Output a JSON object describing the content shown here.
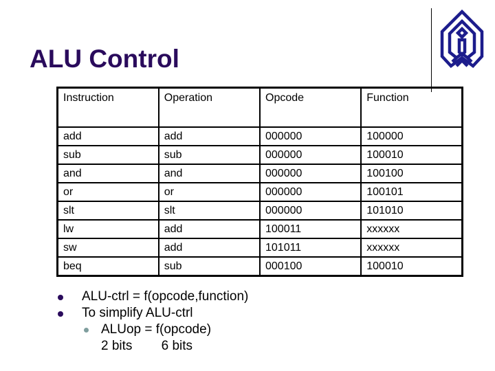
{
  "slide": {
    "title": "ALU Control",
    "logo_icon": "university-emblem-logo",
    "colors": {
      "title": "#2a0b5c",
      "bullet": "#2a0b5c",
      "sub_bullet": "#7f9e9e",
      "logo": "#1c1c8c"
    }
  },
  "table": {
    "headers": [
      "Instruction",
      "Operation",
      "Opcode",
      "Function"
    ],
    "rows": [
      [
        "add",
        "add",
        "000000",
        "100000"
      ],
      [
        "sub",
        "sub",
        "000000",
        "100010"
      ],
      [
        "and",
        "and",
        "000000",
        "100100"
      ],
      [
        "or",
        "or",
        "000000",
        "100101"
      ],
      [
        "slt",
        "slt",
        "000000",
        "101010"
      ],
      [
        "lw",
        "add",
        "100011",
        "xxxxxx"
      ],
      [
        "sw",
        "add",
        "101011",
        "xxxxxx"
      ],
      [
        "beq",
        "sub",
        "000100",
        "100010"
      ]
    ]
  },
  "bullets": [
    {
      "text": "ALU-ctrl = f(opcode,function)"
    },
    {
      "text": "To simplify ALU-ctrl",
      "sub": [
        {
          "text": "ALUop = f(opcode)",
          "note": "2 bits        6 bits"
        }
      ]
    }
  ]
}
